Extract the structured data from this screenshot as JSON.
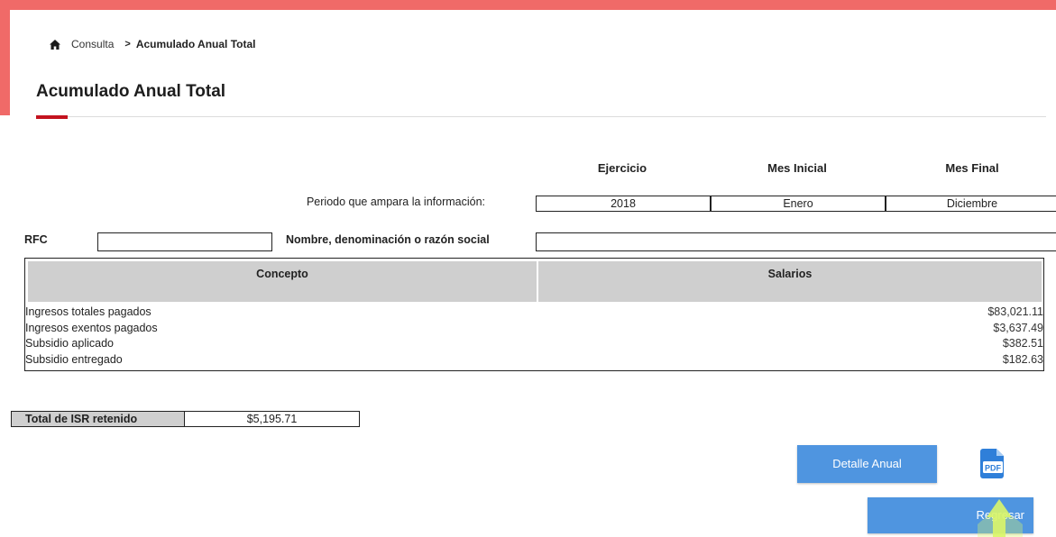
{
  "colors": {
    "accent_red": "#c3121e",
    "frame_red": "#f06a68",
    "button_blue": "#4f95e0",
    "header_gray": "#cfcfcf",
    "cursor_highlight": "#d9f56a"
  },
  "breadcrumb": {
    "home_icon": "home-icon",
    "items": [
      "Consulta"
    ],
    "separator": ">",
    "current": "Acumulado Anual Total"
  },
  "page": {
    "title": "Acumulado Anual Total"
  },
  "period": {
    "label": "Periodo que ampara la información:",
    "headers": {
      "ejercicio": "Ejercicio",
      "mes_inicial": "Mes Inicial",
      "mes_final": "Mes Final"
    },
    "values": {
      "ejercicio": "2018",
      "mes_inicial": "Enero",
      "mes_final": "Diciembre"
    }
  },
  "taxpayer": {
    "rfc_label": "RFC",
    "rfc_value": "",
    "name_label": "Nombre, denominación o razón social",
    "name_value": ""
  },
  "concepts": {
    "headers": {
      "concepto": "Concepto",
      "salarios": "Salarios"
    },
    "rows": [
      {
        "label": "Ingresos totales pagados",
        "value": "$83,021.11"
      },
      {
        "label": "Ingresos exentos pagados",
        "value": "$3,637.49"
      },
      {
        "label": "Subsidio aplicado",
        "value": "$382.51"
      },
      {
        "label": "Subsidio entregado",
        "value": "$182.63"
      }
    ]
  },
  "total": {
    "label": "Total de ISR retenido",
    "value": "$5,195.71"
  },
  "actions": {
    "detalle_label": "Detalle Anual",
    "pdf_icon": "pdf-icon",
    "pdf_text": "PDF",
    "regresar_label": "Regresar"
  }
}
